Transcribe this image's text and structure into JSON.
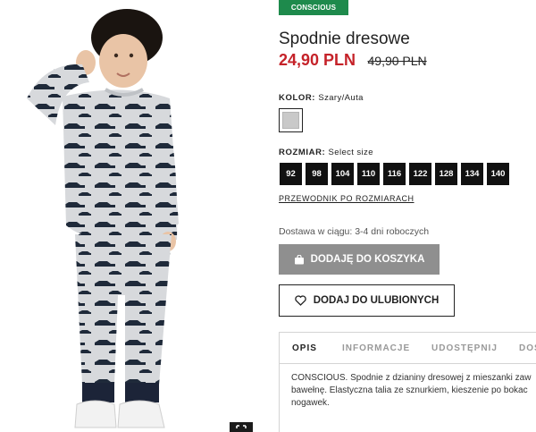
{
  "product": {
    "badge": "CONSCIOUS",
    "title": "Spodnie dresowe",
    "price_now": "24,90 PLN",
    "price_old": "49,90 PLN",
    "color_label": "KOLOR:",
    "color_value": "Szary/Auta",
    "size_label": "ROZMIAR:",
    "size_placeholder": "Select size",
    "sizes": [
      "92",
      "98",
      "104",
      "110",
      "116",
      "122",
      "128",
      "134",
      "140"
    ],
    "size_guide": "PRZEWODNIK PO ROZMIARACH",
    "delivery": "Dostawa w ciągu: 3-4 dni roboczych",
    "add_to_cart": "DODAJĘ DO KOSZYKA",
    "add_to_fav": "DODAJ DO ULUBIONYCH"
  },
  "tabs": [
    "OPIS",
    "INFORMACJE",
    "UDOSTĘPNIJ",
    "DOS"
  ],
  "description": "CONSCIOUS. Spodnie z dzianiny dresowej z mieszanki zaw bawełnę. Elastyczna talia ze sznurkiem, kieszenie po bokac nogawek.",
  "colors": {
    "badge": "#1e8a4c",
    "sale_price": "#c52229",
    "size_bg": "#111111",
    "cart_button": "#8f8f8f"
  }
}
